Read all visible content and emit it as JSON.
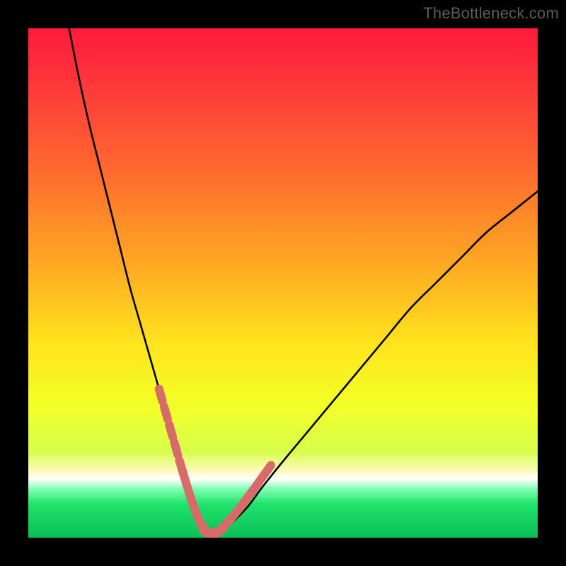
{
  "watermark": {
    "text": "TheBottleneck.com"
  },
  "colors": {
    "gradient_stops": [
      {
        "offset": 0.0,
        "color": "#ff1a3c"
      },
      {
        "offset": 0.12,
        "color": "#ff3a3a"
      },
      {
        "offset": 0.28,
        "color": "#ff6a2e"
      },
      {
        "offset": 0.45,
        "color": "#ffa423"
      },
      {
        "offset": 0.62,
        "color": "#ffe41c"
      },
      {
        "offset": 0.74,
        "color": "#f4ff28"
      },
      {
        "offset": 0.83,
        "color": "#d7ff4a"
      },
      {
        "offset": 0.87,
        "color": "#fffac0"
      },
      {
        "offset": 0.885,
        "color": "#ffffff"
      },
      {
        "offset": 0.905,
        "color": "#7cffb0"
      },
      {
        "offset": 0.935,
        "color": "#1fe26a"
      },
      {
        "offset": 1.0,
        "color": "#0bbf57"
      }
    ],
    "curve": "#000000",
    "markers": "#d86a6a",
    "background": "#000000"
  },
  "chart_data": {
    "type": "line",
    "title": "",
    "xlabel": "",
    "ylabel": "",
    "xlim": [
      0,
      100
    ],
    "ylim": [
      0,
      100
    ],
    "series": [
      {
        "name": "bottleneck-curve",
        "x": [
          8,
          10,
          12,
          14,
          16,
          18,
          20,
          22,
          24,
          26,
          28,
          30,
          31,
          32,
          33,
          34,
          35,
          36,
          38,
          40,
          43,
          46,
          50,
          55,
          60,
          65,
          70,
          75,
          80,
          85,
          90,
          95,
          100
        ],
        "values": [
          100,
          90,
          81,
          73,
          65,
          57,
          49,
          42,
          35,
          28,
          21,
          14,
          11,
          8,
          5,
          3,
          1.5,
          1,
          1.5,
          3,
          6,
          10,
          15,
          21,
          27,
          33,
          39,
          45,
          50,
          55,
          60,
          64,
          68
        ]
      }
    ],
    "markers": {
      "name": "highlight-segment",
      "x": [
        26.0,
        27.0,
        28.0,
        29.0,
        30.0,
        30.6,
        31.3,
        32.0,
        32.7,
        33.4,
        34.1,
        34.8,
        35.5,
        36.3,
        37.1,
        37.9,
        38.9,
        39.9,
        41.0,
        42.1,
        43.2,
        44.4,
        45.6,
        46.9
      ],
      "values": [
        28.0,
        24.5,
        21.0,
        17.5,
        14.0,
        12.0,
        9.7,
        7.5,
        5.5,
        3.8,
        2.4,
        1.5,
        1.0,
        1.0,
        1.2,
        1.8,
        2.8,
        3.9,
        5.2,
        6.6,
        8.1,
        9.7,
        11.4,
        13.2
      ]
    }
  }
}
